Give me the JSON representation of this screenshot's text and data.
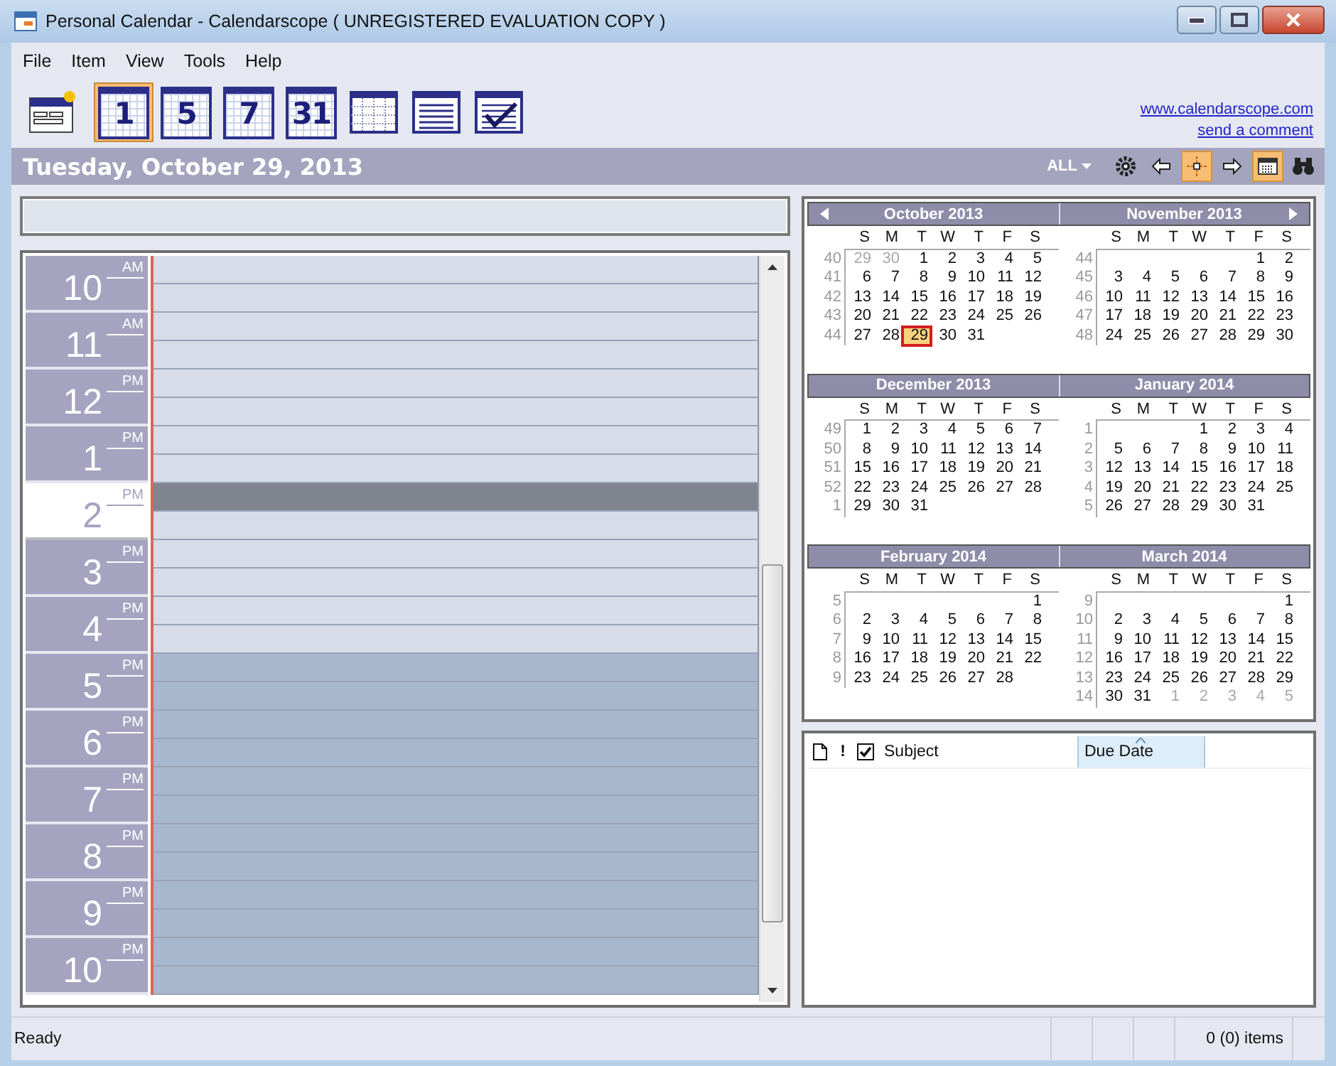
{
  "window": {
    "title": "Personal Calendar - Calendarscope ( UNREGISTERED EVALUATION COPY )"
  },
  "menu": [
    "File",
    "Item",
    "View",
    "Tools",
    "Help"
  ],
  "toolbar": [
    {
      "kind": "new",
      "selected": false
    },
    {
      "kind": "number",
      "label": "1",
      "selected": true
    },
    {
      "kind": "number",
      "label": "5",
      "selected": false
    },
    {
      "kind": "number",
      "label": "7",
      "selected": false
    },
    {
      "kind": "number",
      "label": "31",
      "selected": false
    },
    {
      "kind": "grid",
      "selected": false
    },
    {
      "kind": "list",
      "selected": false
    },
    {
      "kind": "tasks",
      "selected": false
    }
  ],
  "links": [
    "www.calendarscope.com",
    "send a comment"
  ],
  "date_bar": {
    "title": "Tuesday, October 29, 2013",
    "filter": "ALL",
    "tools": [
      {
        "kind": "gear",
        "selected": false
      },
      {
        "kind": "prev",
        "selected": false
      },
      {
        "kind": "today",
        "selected": true
      },
      {
        "kind": "next",
        "selected": false
      },
      {
        "kind": "calendar",
        "selected": true
      },
      {
        "kind": "find",
        "selected": false
      }
    ]
  },
  "day_view": {
    "hours": [
      {
        "hour": "10",
        "period": "AM",
        "working": true,
        "selected": false
      },
      {
        "hour": "11",
        "period": "AM",
        "working": true,
        "selected": false
      },
      {
        "hour": "12",
        "period": "PM",
        "working": true,
        "selected": false
      },
      {
        "hour": "1",
        "period": "PM",
        "working": true,
        "selected": false
      },
      {
        "hour": "2",
        "period": "PM",
        "working": true,
        "selected": true
      },
      {
        "hour": "3",
        "period": "PM",
        "working": true,
        "selected": false
      },
      {
        "hour": "4",
        "period": "PM",
        "working": true,
        "selected": false
      },
      {
        "hour": "5",
        "period": "PM",
        "working": false,
        "selected": false
      },
      {
        "hour": "6",
        "period": "PM",
        "working": false,
        "selected": false
      },
      {
        "hour": "7",
        "period": "PM",
        "working": false,
        "selected": false
      },
      {
        "hour": "8",
        "period": "PM",
        "working": false,
        "selected": false
      },
      {
        "hour": "9",
        "period": "PM",
        "working": false,
        "selected": false
      },
      {
        "hour": "10",
        "period": "PM",
        "working": false,
        "selected": false
      }
    ]
  },
  "mini_calendar": {
    "months": [
      {
        "name": "October 2013",
        "weekdays": [
          "S",
          "M",
          "T",
          "W",
          "T",
          "F",
          "S"
        ],
        "weeks": [
          {
            "week": "40",
            "leading": [
              "29",
              "30"
            ],
            "days": [
              {
                "day": "1",
                "selected": false
              },
              {
                "day": "2",
                "selected": false
              },
              {
                "day": "3",
                "selected": false
              },
              {
                "day": "4",
                "selected": false
              },
              {
                "day": "5",
                "selected": false
              }
            ]
          },
          {
            "week": "41",
            "days": [
              {
                "day": "6",
                "selected": false
              },
              {
                "day": "7",
                "selected": false
              },
              {
                "day": "8",
                "selected": false
              },
              {
                "day": "9",
                "selected": false
              },
              {
                "day": "10",
                "selected": false
              },
              {
                "day": "11",
                "selected": false
              },
              {
                "day": "12",
                "selected": false
              }
            ]
          },
          {
            "week": "42",
            "days": [
              {
                "day": "13",
                "selected": false
              },
              {
                "day": "14",
                "selected": false
              },
              {
                "day": "15",
                "selected": false
              },
              {
                "day": "16",
                "selected": false
              },
              {
                "day": "17",
                "selected": false
              },
              {
                "day": "18",
                "selected": false
              },
              {
                "day": "19",
                "selected": false
              }
            ]
          },
          {
            "week": "43",
            "days": [
              {
                "day": "20",
                "selected": false
              },
              {
                "day": "21",
                "selected": false
              },
              {
                "day": "22",
                "selected": false
              },
              {
                "day": "23",
                "selected": false
              },
              {
                "day": "24",
                "selected": false
              },
              {
                "day": "25",
                "selected": false
              },
              {
                "day": "26",
                "selected": false
              }
            ]
          },
          {
            "week": "44",
            "days": [
              {
                "day": "27",
                "selected": false
              },
              {
                "day": "28",
                "selected": false
              },
              {
                "day": "29",
                "selected": true
              },
              {
                "day": "30",
                "selected": false
              },
              {
                "day": "31",
                "selected": false
              }
            ]
          }
        ]
      },
      {
        "name": "November 2013",
        "weekdays": [
          "S",
          "M",
          "T",
          "W",
          "T",
          "F",
          "S"
        ],
        "weeks": [
          {
            "week": "44",
            "days": [
              {
                "day": "1",
                "selected": false
              },
              {
                "day": "2",
                "selected": false
              }
            ]
          },
          {
            "week": "45",
            "days": [
              {
                "day": "3",
                "selected": false
              },
              {
                "day": "4",
                "selected": false
              },
              {
                "day": "5",
                "selected": false
              },
              {
                "day": "6",
                "selected": false
              },
              {
                "day": "7",
                "selected": false
              },
              {
                "day": "8",
                "selected": false
              },
              {
                "day": "9",
                "selected": false
              }
            ]
          },
          {
            "week": "46",
            "days": [
              {
                "day": "10",
                "selected": false
              },
              {
                "day": "11",
                "selected": false
              },
              {
                "day": "12",
                "selected": false
              },
              {
                "day": "13",
                "selected": false
              },
              {
                "day": "14",
                "selected": false
              },
              {
                "day": "15",
                "selected": false
              },
              {
                "day": "16",
                "selected": false
              }
            ]
          },
          {
            "week": "47",
            "days": [
              {
                "day": "17",
                "selected": false
              },
              {
                "day": "18",
                "selected": false
              },
              {
                "day": "19",
                "selected": false
              },
              {
                "day": "20",
                "selected": false
              },
              {
                "day": "21",
                "selected": false
              },
              {
                "day": "22",
                "selected": false
              },
              {
                "day": "23",
                "selected": false
              }
            ]
          },
          {
            "week": "48",
            "days": [
              {
                "day": "24",
                "selected": false
              },
              {
                "day": "25",
                "selected": false
              },
              {
                "day": "26",
                "selected": false
              },
              {
                "day": "27",
                "selected": false
              },
              {
                "day": "28",
                "selected": false
              },
              {
                "day": "29",
                "selected": false
              },
              {
                "day": "30",
                "selected": false
              }
            ]
          }
        ]
      },
      {
        "name": "December 2013",
        "weekdays": [
          "S",
          "M",
          "T",
          "W",
          "T",
          "F",
          "S"
        ],
        "weeks": [
          {
            "week": "49",
            "days": [
              {
                "day": "1",
                "selected": false
              },
              {
                "day": "2",
                "selected": false
              },
              {
                "day": "3",
                "selected": false
              },
              {
                "day": "4",
                "selected": false
              },
              {
                "day": "5",
                "selected": false
              },
              {
                "day": "6",
                "selected": false
              },
              {
                "day": "7",
                "selected": false
              }
            ]
          },
          {
            "week": "50",
            "days": [
              {
                "day": "8",
                "selected": false
              },
              {
                "day": "9",
                "selected": false
              },
              {
                "day": "10",
                "selected": false
              },
              {
                "day": "11",
                "selected": false
              },
              {
                "day": "12",
                "selected": false
              },
              {
                "day": "13",
                "selected": false
              },
              {
                "day": "14",
                "selected": false
              }
            ]
          },
          {
            "week": "51",
            "days": [
              {
                "day": "15",
                "selected": false
              },
              {
                "day": "16",
                "selected": false
              },
              {
                "day": "17",
                "selected": false
              },
              {
                "day": "18",
                "selected": false
              },
              {
                "day": "19",
                "selected": false
              },
              {
                "day": "20",
                "selected": false
              },
              {
                "day": "21",
                "selected": false
              }
            ]
          },
          {
            "week": "52",
            "days": [
              {
                "day": "22",
                "selected": false
              },
              {
                "day": "23",
                "selected": false
              },
              {
                "day": "24",
                "selected": false
              },
              {
                "day": "25",
                "selected": false
              },
              {
                "day": "26",
                "selected": false
              },
              {
                "day": "27",
                "selected": false
              },
              {
                "day": "28",
                "selected": false
              }
            ]
          },
          {
            "week": "1",
            "days": [
              {
                "day": "29",
                "selected": false
              },
              {
                "day": "30",
                "selected": false
              },
              {
                "day": "31",
                "selected": false
              }
            ]
          }
        ]
      },
      {
        "name": "January 2014",
        "weekdays": [
          "S",
          "M",
          "T",
          "W",
          "T",
          "F",
          "S"
        ],
        "weeks": [
          {
            "week": "1",
            "days": [
              {
                "day": "1",
                "selected": false
              },
              {
                "day": "2",
                "selected": false
              },
              {
                "day": "3",
                "selected": false
              },
              {
                "day": "4",
                "selected": false
              }
            ]
          },
          {
            "week": "2",
            "days": [
              {
                "day": "5",
                "selected": false
              },
              {
                "day": "6",
                "selected": false
              },
              {
                "day": "7",
                "selected": false
              },
              {
                "day": "8",
                "selected": false
              },
              {
                "day": "9",
                "selected": false
              },
              {
                "day": "10",
                "selected": false
              },
              {
                "day": "11",
                "selected": false
              }
            ]
          },
          {
            "week": "3",
            "days": [
              {
                "day": "12",
                "selected": false
              },
              {
                "day": "13",
                "selected": false
              },
              {
                "day": "14",
                "selected": false
              },
              {
                "day": "15",
                "selected": false
              },
              {
                "day": "16",
                "selected": false
              },
              {
                "day": "17",
                "selected": false
              },
              {
                "day": "18",
                "selected": false
              }
            ]
          },
          {
            "week": "4",
            "days": [
              {
                "day": "19",
                "selected": false
              },
              {
                "day": "20",
                "selected": false
              },
              {
                "day": "21",
                "selected": false
              },
              {
                "day": "22",
                "selected": false
              },
              {
                "day": "23",
                "selected": false
              },
              {
                "day": "24",
                "selected": false
              },
              {
                "day": "25",
                "selected": false
              }
            ]
          },
          {
            "week": "5",
            "days": [
              {
                "day": "26",
                "selected": false
              },
              {
                "day": "27",
                "selected": false
              },
              {
                "day": "28",
                "selected": false
              },
              {
                "day": "29",
                "selected": false
              },
              {
                "day": "30",
                "selected": false
              },
              {
                "day": "31",
                "selected": false
              }
            ]
          }
        ]
      },
      {
        "name": "February 2014",
        "weekdays": [
          "S",
          "M",
          "T",
          "W",
          "T",
          "F",
          "S"
        ],
        "weeks": [
          {
            "week": "5",
            "days": [
              {
                "day": "1",
                "selected": false
              }
            ]
          },
          {
            "week": "6",
            "days": [
              {
                "day": "2",
                "selected": false
              },
              {
                "day": "3",
                "selected": false
              },
              {
                "day": "4",
                "selected": false
              },
              {
                "day": "5",
                "selected": false
              },
              {
                "day": "6",
                "selected": false
              },
              {
                "day": "7",
                "selected": false
              },
              {
                "day": "8",
                "selected": false
              }
            ]
          },
          {
            "week": "7",
            "days": [
              {
                "day": "9",
                "selected": false
              },
              {
                "day": "10",
                "selected": false
              },
              {
                "day": "11",
                "selected": false
              },
              {
                "day": "12",
                "selected": false
              },
              {
                "day": "13",
                "selected": false
              },
              {
                "day": "14",
                "selected": false
              },
              {
                "day": "15",
                "selected": false
              }
            ]
          },
          {
            "week": "8",
            "days": [
              {
                "day": "16",
                "selected": false
              },
              {
                "day": "17",
                "selected": false
              },
              {
                "day": "18",
                "selected": false
              },
              {
                "day": "19",
                "selected": false
              },
              {
                "day": "20",
                "selected": false
              },
              {
                "day": "21",
                "selected": false
              },
              {
                "day": "22",
                "selected": false
              }
            ]
          },
          {
            "week": "9",
            "days": [
              {
                "day": "23",
                "selected": false
              },
              {
                "day": "24",
                "selected": false
              },
              {
                "day": "25",
                "selected": false
              },
              {
                "day": "26",
                "selected": false
              },
              {
                "day": "27",
                "selected": false
              },
              {
                "day": "28",
                "selected": false
              }
            ]
          }
        ]
      },
      {
        "name": "March 2014",
        "weekdays": [
          "S",
          "M",
          "T",
          "W",
          "T",
          "F",
          "S"
        ],
        "weeks": [
          {
            "week": "9",
            "days": [
              {
                "day": "1",
                "selected": false
              }
            ]
          },
          {
            "week": "10",
            "days": [
              {
                "day": "2",
                "selected": false
              },
              {
                "day": "3",
                "selected": false
              },
              {
                "day": "4",
                "selected": false
              },
              {
                "day": "5",
                "selected": false
              },
              {
                "day": "6",
                "selected": false
              },
              {
                "day": "7",
                "selected": false
              },
              {
                "day": "8",
                "selected": false
              }
            ]
          },
          {
            "week": "11",
            "days": [
              {
                "day": "9",
                "selected": false
              },
              {
                "day": "10",
                "selected": false
              },
              {
                "day": "11",
                "selected": false
              },
              {
                "day": "12",
                "selected": false
              },
              {
                "day": "13",
                "selected": false
              },
              {
                "day": "14",
                "selected": false
              },
              {
                "day": "15",
                "selected": false
              }
            ]
          },
          {
            "week": "12",
            "days": [
              {
                "day": "16",
                "selected": false
              },
              {
                "day": "17",
                "selected": false
              },
              {
                "day": "18",
                "selected": false
              },
              {
                "day": "19",
                "selected": false
              },
              {
                "day": "20",
                "selected": false
              },
              {
                "day": "21",
                "selected": false
              },
              {
                "day": "22",
                "selected": false
              }
            ]
          },
          {
            "week": "13",
            "days": [
              {
                "day": "23",
                "selected": false
              },
              {
                "day": "24",
                "selected": false
              },
              {
                "day": "25",
                "selected": false
              },
              {
                "day": "26",
                "selected": false
              },
              {
                "day": "27",
                "selected": false
              },
              {
                "day": "28",
                "selected": false
              },
              {
                "day": "29",
                "selected": false
              }
            ]
          },
          {
            "week": "14",
            "days": [
              {
                "day": "30",
                "selected": false
              },
              {
                "day": "31",
                "selected": false
              }
            ],
            "trailing": [
              "1",
              "2",
              "3",
              "4",
              "5"
            ]
          }
        ]
      }
    ]
  },
  "task_list": {
    "columns": [
      {
        "kind": "page-icon",
        "sorted": false
      },
      {
        "kind": "text",
        "label": "!",
        "sorted": false
      },
      {
        "kind": "check-icon",
        "sorted": false
      },
      {
        "kind": "text",
        "label": "Subject",
        "sorted": false
      },
      {
        "kind": "text",
        "label": "Due Date",
        "sorted": true
      }
    ]
  },
  "status_bar": {
    "message": "Ready",
    "count": "0 (0) items"
  }
}
